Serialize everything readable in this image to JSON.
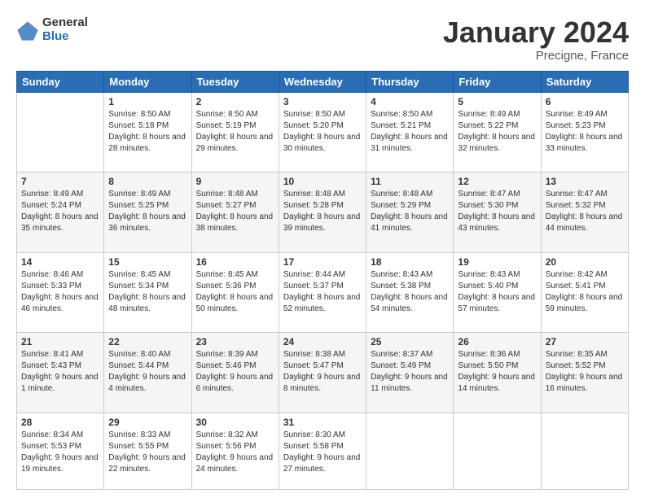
{
  "logo": {
    "general": "General",
    "blue": "Blue"
  },
  "header": {
    "month": "January 2024",
    "location": "Precigne, France"
  },
  "weekdays": [
    "Sunday",
    "Monday",
    "Tuesday",
    "Wednesday",
    "Thursday",
    "Friday",
    "Saturday"
  ],
  "weeks": [
    [
      null,
      {
        "day": "1",
        "sunrise": "8:50 AM",
        "sunset": "5:18 PM",
        "daylight": "8 hours and 28 minutes."
      },
      {
        "day": "2",
        "sunrise": "8:50 AM",
        "sunset": "5:19 PM",
        "daylight": "8 hours and 29 minutes."
      },
      {
        "day": "3",
        "sunrise": "8:50 AM",
        "sunset": "5:20 PM",
        "daylight": "8 hours and 30 minutes."
      },
      {
        "day": "4",
        "sunrise": "8:50 AM",
        "sunset": "5:21 PM",
        "daylight": "8 hours and 31 minutes."
      },
      {
        "day": "5",
        "sunrise": "8:49 AM",
        "sunset": "5:22 PM",
        "daylight": "8 hours and 32 minutes."
      },
      {
        "day": "6",
        "sunrise": "8:49 AM",
        "sunset": "5:23 PM",
        "daylight": "8 hours and 33 minutes."
      }
    ],
    [
      {
        "day": "7",
        "sunrise": "8:49 AM",
        "sunset": "5:24 PM",
        "daylight": "8 hours and 35 minutes."
      },
      {
        "day": "8",
        "sunrise": "8:49 AM",
        "sunset": "5:25 PM",
        "daylight": "8 hours and 36 minutes."
      },
      {
        "day": "9",
        "sunrise": "8:48 AM",
        "sunset": "5:27 PM",
        "daylight": "8 hours and 38 minutes."
      },
      {
        "day": "10",
        "sunrise": "8:48 AM",
        "sunset": "5:28 PM",
        "daylight": "8 hours and 39 minutes."
      },
      {
        "day": "11",
        "sunrise": "8:48 AM",
        "sunset": "5:29 PM",
        "daylight": "8 hours and 41 minutes."
      },
      {
        "day": "12",
        "sunrise": "8:47 AM",
        "sunset": "5:30 PM",
        "daylight": "8 hours and 43 minutes."
      },
      {
        "day": "13",
        "sunrise": "8:47 AM",
        "sunset": "5:32 PM",
        "daylight": "8 hours and 44 minutes."
      }
    ],
    [
      {
        "day": "14",
        "sunrise": "8:46 AM",
        "sunset": "5:33 PM",
        "daylight": "8 hours and 46 minutes."
      },
      {
        "day": "15",
        "sunrise": "8:45 AM",
        "sunset": "5:34 PM",
        "daylight": "8 hours and 48 minutes."
      },
      {
        "day": "16",
        "sunrise": "8:45 AM",
        "sunset": "5:36 PM",
        "daylight": "8 hours and 50 minutes."
      },
      {
        "day": "17",
        "sunrise": "8:44 AM",
        "sunset": "5:37 PM",
        "daylight": "8 hours and 52 minutes."
      },
      {
        "day": "18",
        "sunrise": "8:43 AM",
        "sunset": "5:38 PM",
        "daylight": "8 hours and 54 minutes."
      },
      {
        "day": "19",
        "sunrise": "8:43 AM",
        "sunset": "5:40 PM",
        "daylight": "8 hours and 57 minutes."
      },
      {
        "day": "20",
        "sunrise": "8:42 AM",
        "sunset": "5:41 PM",
        "daylight": "8 hours and 59 minutes."
      }
    ],
    [
      {
        "day": "21",
        "sunrise": "8:41 AM",
        "sunset": "5:43 PM",
        "daylight": "9 hours and 1 minute."
      },
      {
        "day": "22",
        "sunrise": "8:40 AM",
        "sunset": "5:44 PM",
        "daylight": "9 hours and 4 minutes."
      },
      {
        "day": "23",
        "sunrise": "8:39 AM",
        "sunset": "5:46 PM",
        "daylight": "9 hours and 6 minutes."
      },
      {
        "day": "24",
        "sunrise": "8:38 AM",
        "sunset": "5:47 PM",
        "daylight": "9 hours and 8 minutes."
      },
      {
        "day": "25",
        "sunrise": "8:37 AM",
        "sunset": "5:49 PM",
        "daylight": "9 hours and 11 minutes."
      },
      {
        "day": "26",
        "sunrise": "8:36 AM",
        "sunset": "5:50 PM",
        "daylight": "9 hours and 14 minutes."
      },
      {
        "day": "27",
        "sunrise": "8:35 AM",
        "sunset": "5:52 PM",
        "daylight": "9 hours and 16 minutes."
      }
    ],
    [
      {
        "day": "28",
        "sunrise": "8:34 AM",
        "sunset": "5:53 PM",
        "daylight": "9 hours and 19 minutes."
      },
      {
        "day": "29",
        "sunrise": "8:33 AM",
        "sunset": "5:55 PM",
        "daylight": "9 hours and 22 minutes."
      },
      {
        "day": "30",
        "sunrise": "8:32 AM",
        "sunset": "5:56 PM",
        "daylight": "9 hours and 24 minutes."
      },
      {
        "day": "31",
        "sunrise": "8:30 AM",
        "sunset": "5:58 PM",
        "daylight": "9 hours and 27 minutes."
      },
      null,
      null,
      null
    ]
  ],
  "labels": {
    "sunrise": "Sunrise:",
    "sunset": "Sunset:",
    "daylight": "Daylight:"
  }
}
